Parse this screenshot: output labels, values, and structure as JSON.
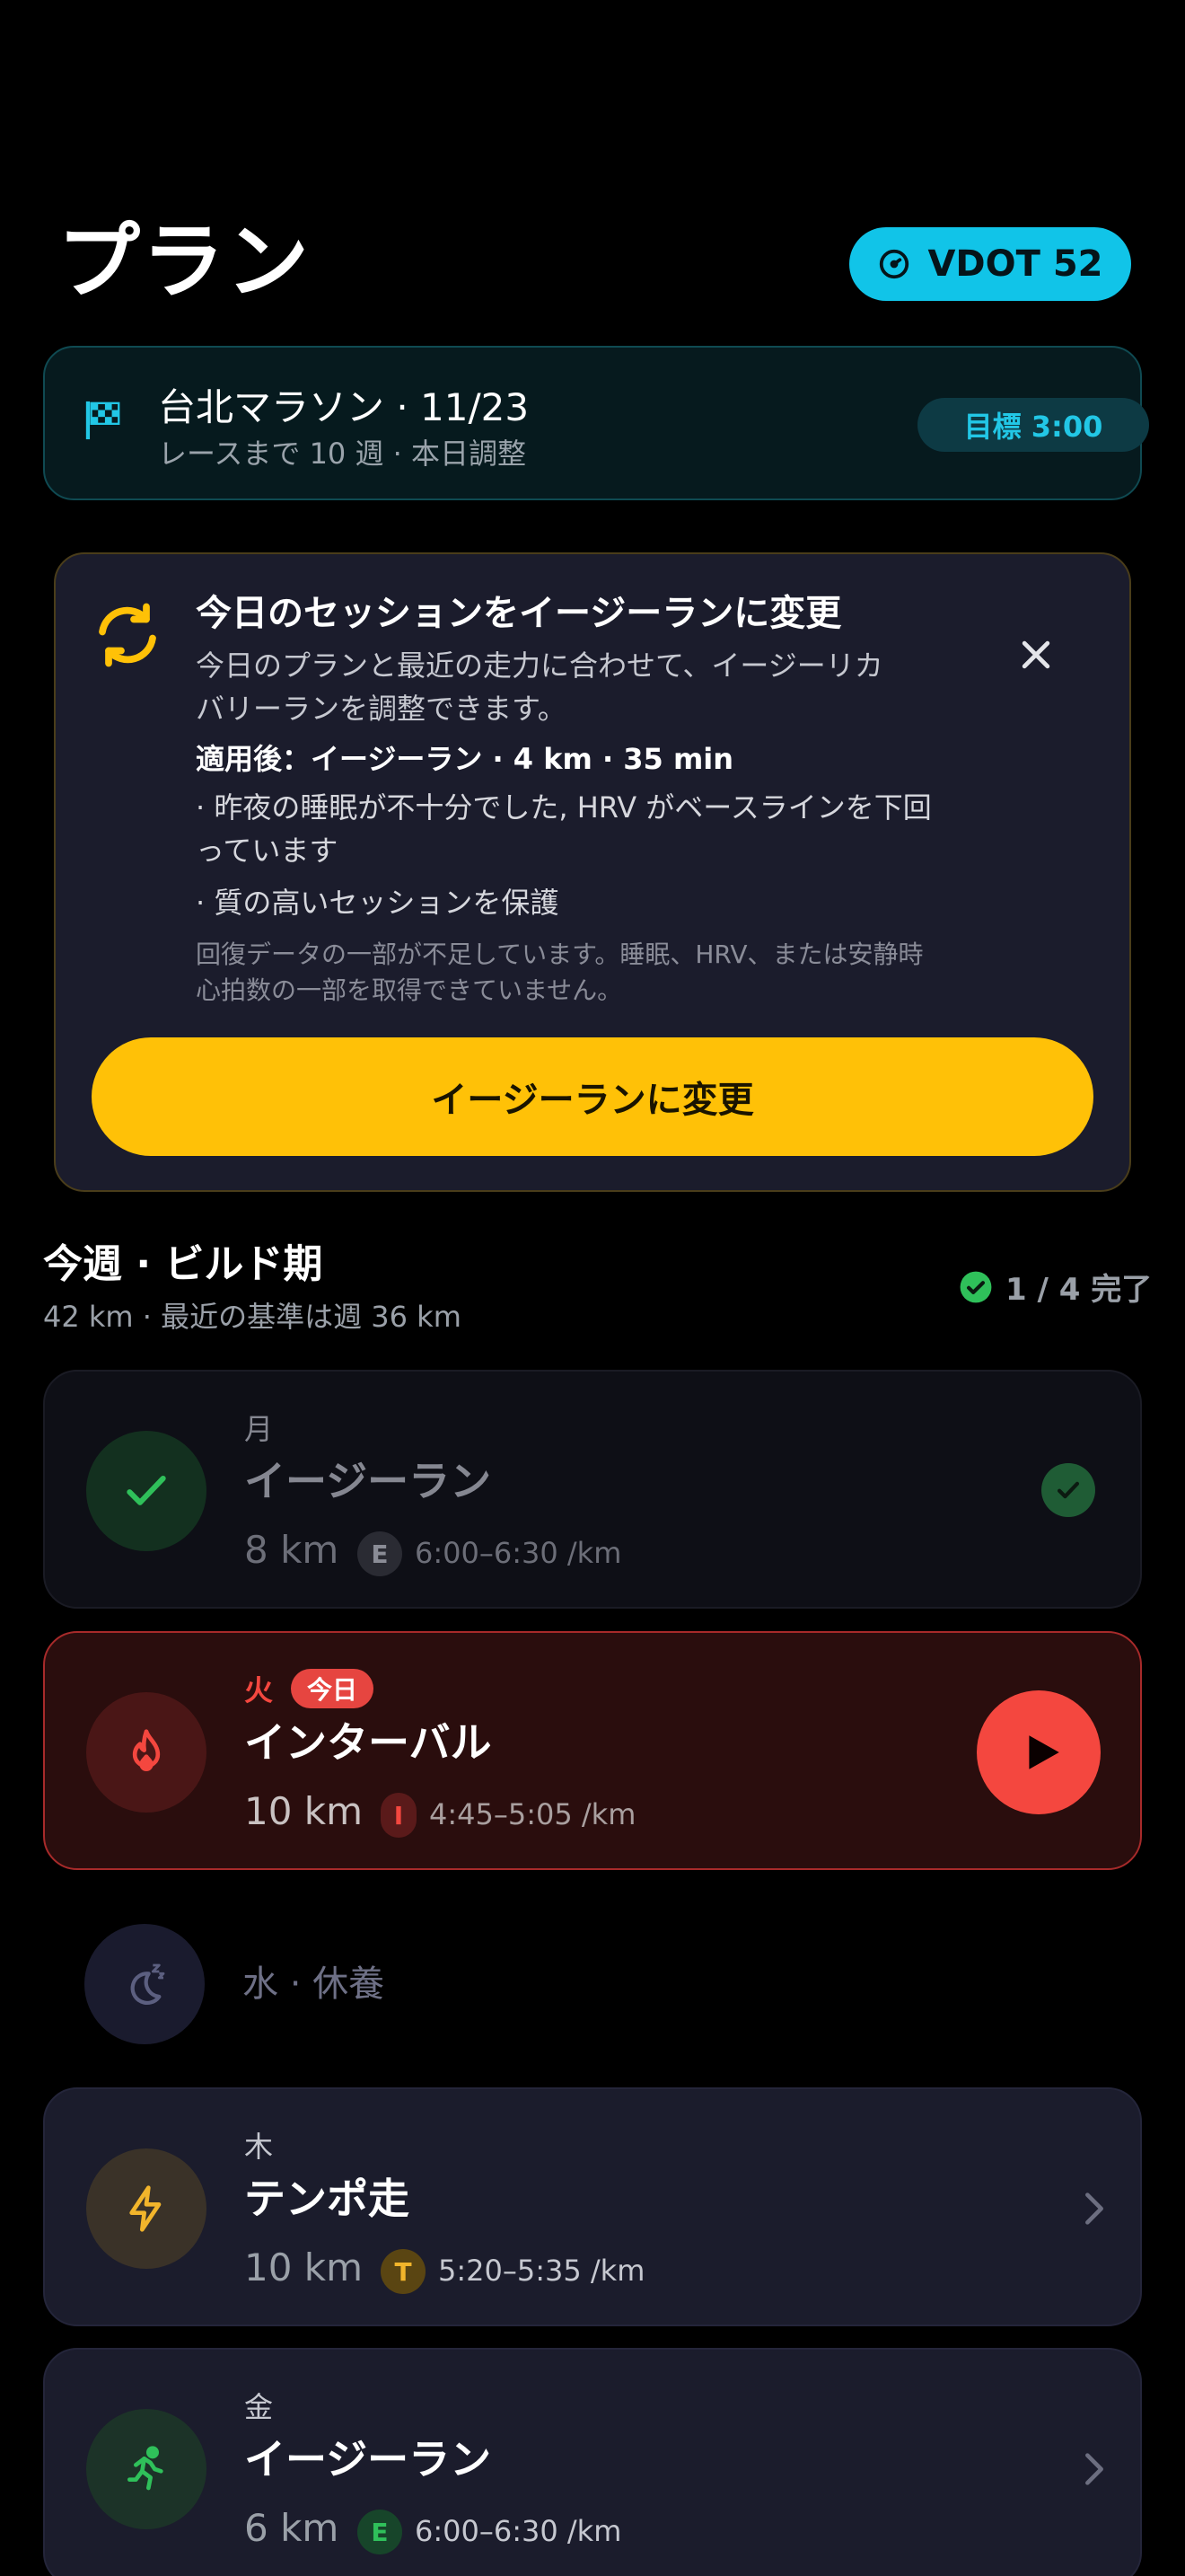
{
  "header": {
    "title": "プラン",
    "vdot_label": "VDOT 52"
  },
  "race": {
    "title": "台北マラソン · 11/23",
    "subtitle": "レースまで 10 週 · 本日調整",
    "goal": "目標 3:00",
    "icon": "checkered-flag-icon"
  },
  "suggestion": {
    "title": "今日のセッションをイージーランに変更",
    "description": "今日のプランと最近の走力に合わせて、イージーリカバリーランを調整できます。",
    "applied": "適用後：イージーラン · 4 km · 35 min",
    "reason_1": "· 昨夜の睡眠が不十分でした, HRV がベースラインを下回っています",
    "reason_2": "· 質の高いセッションを保護",
    "note": "回復データの一部が不足しています。睡眠、HRV、または安静時心拍数の一部を取得できていません。",
    "cta_label": "イージーランに変更",
    "icon": "sync-arrows-icon"
  },
  "week": {
    "title": "今週 · ビルド期",
    "subtitle": "42 km · 最近の基準は週 36 km",
    "progress": "1 / 4 完了"
  },
  "sessions": [
    {
      "day": "月",
      "name": "イージーラン",
      "distance": "8 km",
      "zone": "E",
      "pace": "6:00–6:30 /km",
      "status": "done",
      "icon": "check-icon"
    },
    {
      "day": "火",
      "today_label": "今日",
      "name": "インターバル",
      "distance": "10 km",
      "zone": "I",
      "pace": "4:45–5:05 /km",
      "status": "today",
      "icon": "flame-icon"
    },
    {
      "label": "水 · 休養",
      "status": "rest",
      "icon": "moon-sleep-icon"
    },
    {
      "day": "木",
      "name": "テンポ走",
      "distance": "10 km",
      "zone": "T",
      "pace": "5:20–5:35 /km",
      "status": "upcoming",
      "icon": "lightning-icon"
    },
    {
      "day": "金",
      "name": "イージーラン",
      "distance": "6 km",
      "zone": "E",
      "pace": "6:00–6:30 /km",
      "status": "upcoming",
      "icon": "runner-icon"
    }
  ],
  "colors": {
    "accent_cyan": "#11c4e8",
    "accent_yellow": "#ffc107",
    "today_red": "#f4473f",
    "done_green": "#2fc05a"
  }
}
